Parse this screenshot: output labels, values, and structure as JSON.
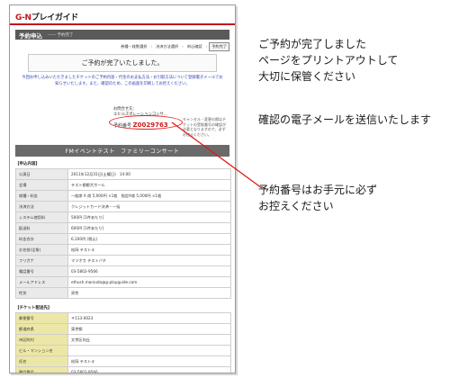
{
  "header": {
    "logo_brand": "G-N",
    "logo_rest": "プレイガイド",
    "page_title": "予約申込",
    "page_subtitle": "—— 予約完了"
  },
  "steps": [
    {
      "label": "券種・枚数選択",
      "current": false
    },
    {
      "label": "決済方法選択",
      "current": false
    },
    {
      "label": "申込確認",
      "current": false
    },
    {
      "label": "予約完了",
      "current": true
    }
  ],
  "complete_message": "ご予約が完了いたしました。",
  "notice": "今回お申し込みいただきましたチケットのご予約内容・代金のお支払方法・お引取方法について登録電子メールでお知らせいたします。また、確認のため、この画面を印刷してお控えください。",
  "inquiry": {
    "label": "お問合せ先：",
    "value": "エヒルズポレーションコンサ..."
  },
  "reservation": {
    "label": "予約番号",
    "number": "Z0029763"
  },
  "side_note": "キャンセル・変更の際はチケットの受取番号の確認が必要となりますので、必ずお控えください。",
  "event_title": "FMイベントテスト　ファミリーコンサート",
  "details": {
    "heading": "【申込内容】",
    "rows": [
      {
        "k": "公演日",
        "v": "2011年12月31日(土曜日)　14:00"
      },
      {
        "k": "会場",
        "v": "テスト都都大ホール"
      },
      {
        "k": "席種・料金",
        "v": "一般席 A 席 5,000円 ×1枚　指定A席 5,000円 ×1枚"
      },
      {
        "k": "決済方法",
        "v": "クレジットカード決済・一括"
      },
      {
        "k": "システム使用料",
        "v": "500円 [1件あたり]"
      },
      {
        "k": "配送料",
        "v": "600円 [1件あたり]"
      },
      {
        "k": "料金合計",
        "v": "6,100円 (税込)"
      },
      {
        "k": "お名前(全角)",
        "v": "松岡 テストキ"
      },
      {
        "k": "フリガナ",
        "v": "マツオカ テストバチ"
      },
      {
        "k": "電話番号",
        "v": "03-5802-9566"
      },
      {
        "k": "メールアドレス",
        "v": "ethush.marsuda@g-playguide.com"
      },
      {
        "k": "性別",
        "v": "男性"
      }
    ]
  },
  "ticket": {
    "heading": "【チケット配送先】",
    "rows": [
      {
        "k": "郵便番号",
        "v": "〒113-0023"
      },
      {
        "k": "都道府県",
        "v": "東京都"
      },
      {
        "k": "市区町村",
        "v": "文京区向丘"
      },
      {
        "k": "ビル・マンション名",
        "v": ""
      },
      {
        "k": "氏名",
        "v": "松岡 テストキ"
      },
      {
        "k": "電話番号",
        "v": "03-5802-9566"
      }
    ]
  },
  "annotations": {
    "print_line1": "ご予約が完了しました",
    "print_line2": "ページをプリントアウトして",
    "print_line3": "大切に保管ください",
    "email_line": "確認の電子メールを送信いたします",
    "number_line1": "予約番号はお手元に必ず",
    "number_line2": "お控えください"
  },
  "colors": {
    "brand_red": "#c0171f",
    "notice_blue": "#2b3fb0",
    "ticket_key_bg": "#ece7a6",
    "highlight_red": "#e01a1a"
  }
}
